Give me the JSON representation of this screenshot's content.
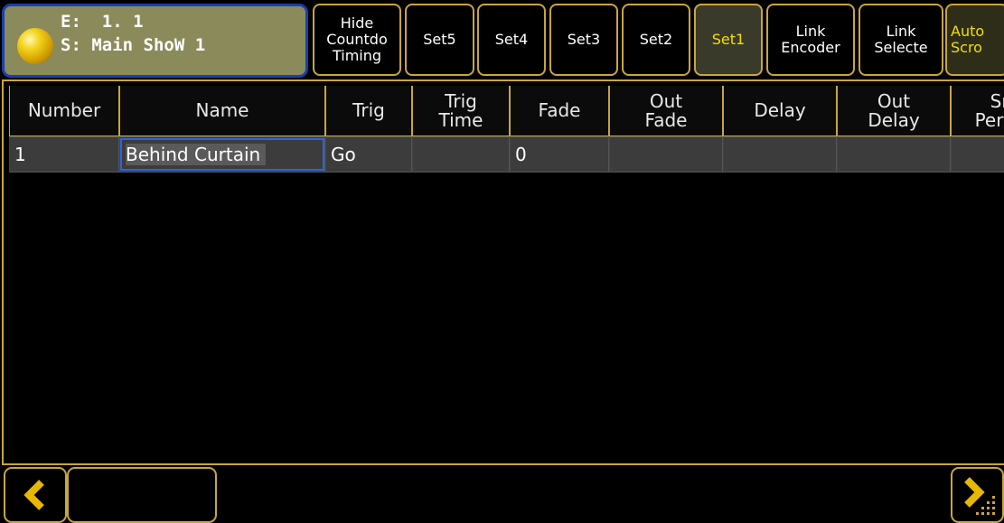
{
  "title": {
    "exec_line": "E:  1. 1",
    "show_line": "S: Main ShoW 1"
  },
  "toolbar": {
    "hide_countdown": [
      "Hide",
      "Countdo",
      "Timing"
    ],
    "set5": "Set5",
    "set4": "Set4",
    "set3": "Set3",
    "set2": "Set2",
    "set1": "Set1",
    "link_encoder": [
      "Link",
      "Encoder"
    ],
    "link_selected": [
      "Link",
      "Selecte"
    ],
    "auto_scroll": [
      "Auto",
      "Scro"
    ]
  },
  "table": {
    "columns": [
      {
        "lines": [
          "Number"
        ]
      },
      {
        "lines": [
          "Name"
        ]
      },
      {
        "lines": [
          "Trig"
        ]
      },
      {
        "lines": [
          "Trig",
          "Time"
        ]
      },
      {
        "lines": [
          "Fade"
        ]
      },
      {
        "lines": [
          "Out",
          "Fade"
        ]
      },
      {
        "lines": [
          "Delay"
        ]
      },
      {
        "lines": [
          "Out",
          "Delay"
        ]
      },
      {
        "lines": [
          "Sn",
          "Perc"
        ]
      }
    ],
    "rows": [
      {
        "number": "1",
        "name": "Behind Curtain",
        "trig": "Go",
        "trig_time": "",
        "fade": "0",
        "out_fade": "",
        "delay": "",
        "out_delay": "",
        "snap_percent": ""
      }
    ]
  },
  "colors": {
    "accent": "#c9a63b",
    "active_text": "#f0e000",
    "title_bg": "#8a8a5a",
    "title_border": "#1a3fb0",
    "selection": "#2c63e6"
  },
  "icons": {
    "scroll_left": "chevron-left-icon",
    "scroll_right": "chevron-right-icon"
  }
}
